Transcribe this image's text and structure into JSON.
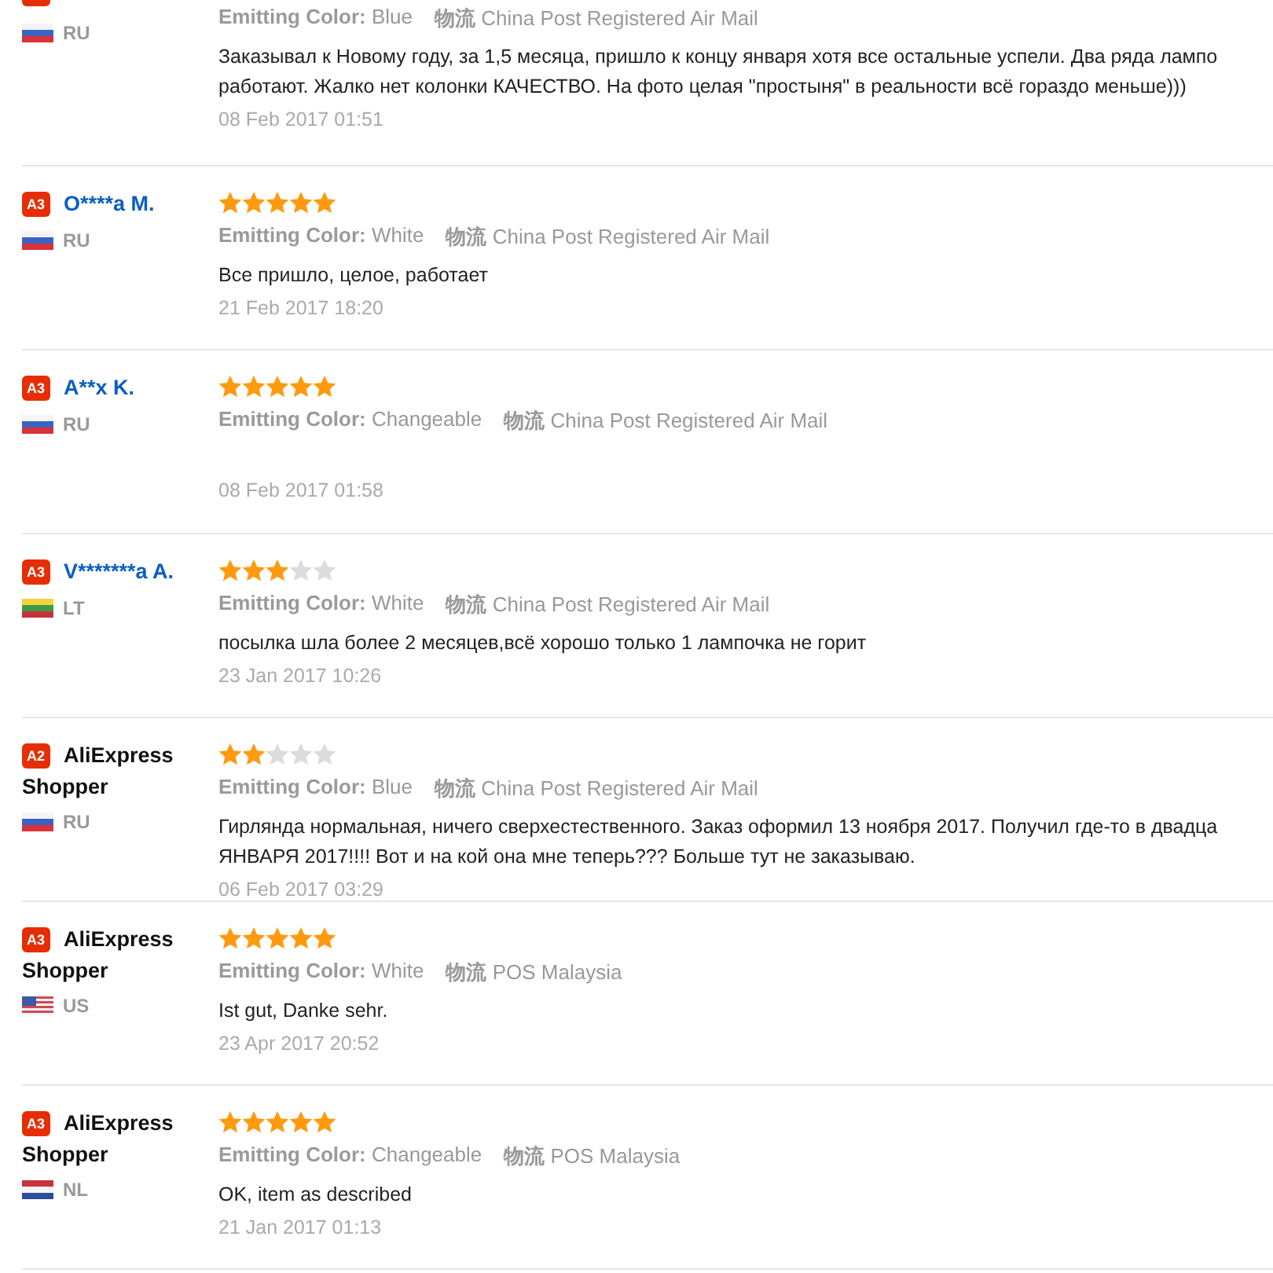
{
  "reviews": [
    {
      "cut_badge": true,
      "country": "RU",
      "kind": "ru",
      "color_label": "Emitting Color:",
      "color_value": "Blue",
      "shipping_label": "物流",
      "shipping": "China Post Registered Air Mail",
      "text_lines": [
        "Заказывал к Новому году, за 1,5 месяца, пришло к концу января хотя все остальные успели. Два ряда лампо",
        "работают. Жалко нет колонки КАЧЕСТВО. На фото целая \"простыня\" в реальности всё гораздо меньше)))"
      ],
      "date": "08 Feb 2017 01:51"
    },
    {
      "badge": "A3",
      "name_lines": [
        "O****a M."
      ],
      "name_link": true,
      "stars": 5,
      "country": "RU",
      "kind": "ru",
      "color_label": "Emitting Color:",
      "color_value": "White",
      "shipping_label": "物流",
      "shipping": "China Post Registered Air Mail",
      "text_lines": [
        "Все пришло, целое, работает"
      ],
      "date": "21 Feb 2017 18:20"
    },
    {
      "badge": "A3",
      "name_lines": [
        "A**x K."
      ],
      "name_link": true,
      "stars": 5,
      "country": "RU",
      "kind": "ru",
      "color_label": "Emitting Color:",
      "color_value": "Changeable",
      "shipping_label": "物流",
      "shipping": "China Post Registered Air Mail",
      "date": "08 Feb 2017 01:58"
    },
    {
      "badge": "A3",
      "name_lines": [
        "V*******a A."
      ],
      "name_link": true,
      "stars": 3,
      "country": "LT",
      "kind": "lt",
      "color_label": "Emitting Color:",
      "color_value": "White",
      "shipping_label": "物流",
      "shipping": "China Post Registered Air Mail",
      "text_lines": [
        "посылка шла более 2 месяцев,всё хорошо только 1 лампочка не горит"
      ],
      "date": "23 Jan 2017 10:26"
    },
    {
      "badge": "A2",
      "name_lines": [
        "AliExpress",
        "Shopper"
      ],
      "name_link": false,
      "stars": 2,
      "country": "RU",
      "kind": "ru",
      "color_label": "Emitting Color:",
      "color_value": "Blue",
      "shipping_label": "物流",
      "shipping": "China Post Registered Air Mail",
      "text_lines": [
        "Гирлянда нормальная, ничего сверхестественного. Заказ оформил 13 ноября 2017. Получил где-то в двадца",
        "ЯНВАРЯ 2017!!!! Вот и на кой она мне теперь??? Больше тут не заказываю."
      ],
      "date": "06 Feb 2017 03:29"
    },
    {
      "badge": "A3",
      "name_lines": [
        "AliExpress",
        "Shopper"
      ],
      "name_link": false,
      "stars": 5,
      "country": "US",
      "kind": "us",
      "color_label": "Emitting Color:",
      "color_value": "White",
      "shipping_label": "物流",
      "shipping": "POS Malaysia",
      "text_lines": [
        "Ist gut, Danke sehr."
      ],
      "date": "23 Apr 2017 20:52"
    },
    {
      "badge": "A3",
      "name_lines": [
        "AliExpress",
        "Shopper"
      ],
      "name_link": false,
      "stars": 5,
      "country": "NL",
      "kind": "nl",
      "color_label": "Emitting Color:",
      "color_value": "Changeable",
      "shipping_label": "物流",
      "shipping": "POS Malaysia",
      "text_lines": [
        "OK, item as described"
      ],
      "date": "21 Jan 2017 01:13"
    }
  ]
}
